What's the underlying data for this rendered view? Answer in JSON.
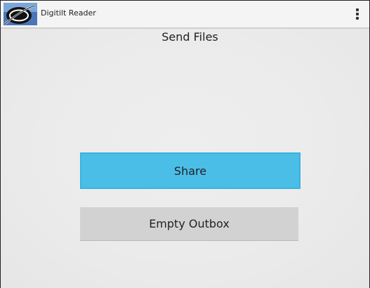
{
  "app": {
    "title": "Digitilt Reader",
    "icon": "digitilt-logo-icon"
  },
  "action_bar": {
    "overflow_icon": "overflow-menu-icon"
  },
  "main": {
    "page_title": "Send Files",
    "share_label": "Share",
    "empty_outbox_label": "Empty Outbox"
  },
  "colors": {
    "share_button": "#4bbee8",
    "empty_outbox_button": "#d2d2d2",
    "background": "#ececec"
  }
}
